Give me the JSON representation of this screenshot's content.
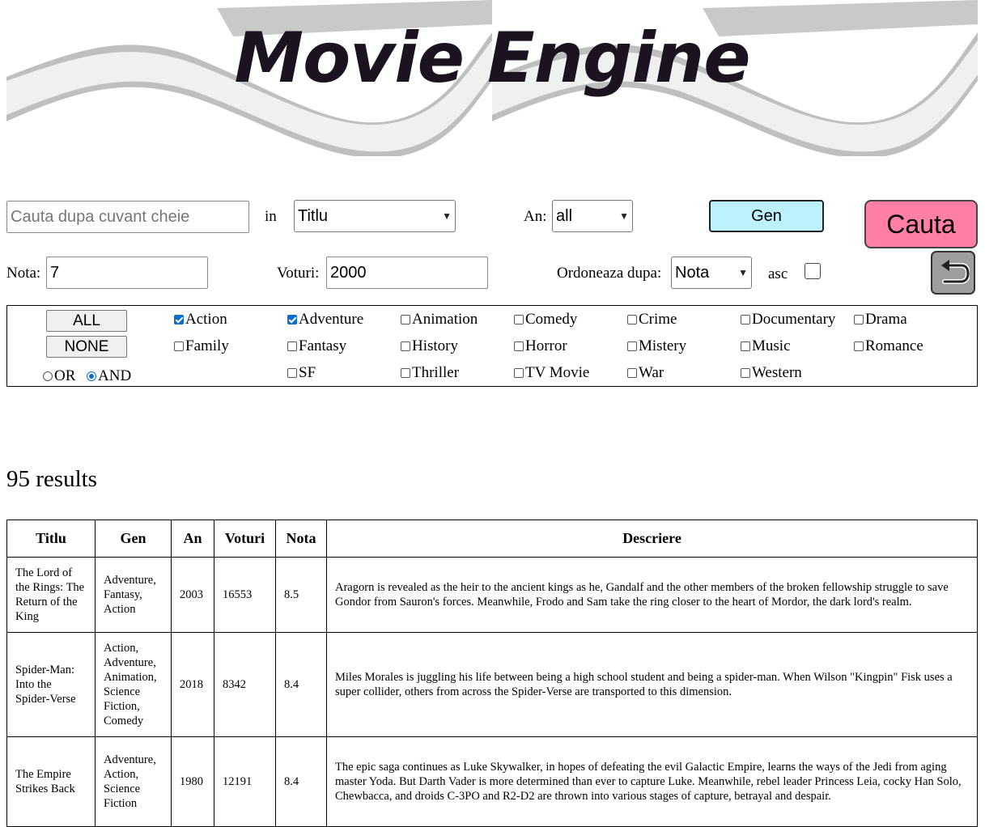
{
  "header": {
    "logo_text": "Movie Engine"
  },
  "search": {
    "keyword_placeholder": "Cauta dupa cuvant cheie",
    "in_label": "in",
    "field_selected": "Titlu",
    "year_label": "An:",
    "year_selected": "all",
    "genre_button": "Gen",
    "search_button": "Cauta",
    "rating_label": "Nota:",
    "rating_value": "7",
    "votes_label": "Voturi:",
    "votes_value": "2000",
    "sort_label": "Ordoneaza dupa:",
    "sort_selected": "Nota",
    "asc_label": "asc",
    "asc_checked": false
  },
  "genres": {
    "all_button": "ALL",
    "none_button": "NONE",
    "or_label": "OR",
    "and_label": "AND",
    "mode_selected": "AND",
    "items": [
      {
        "label": "Action",
        "checked": true
      },
      {
        "label": "Adventure",
        "checked": true
      },
      {
        "label": "Animation",
        "checked": false
      },
      {
        "label": "Comedy",
        "checked": false
      },
      {
        "label": "Crime",
        "checked": false
      },
      {
        "label": "Documentary",
        "checked": false
      },
      {
        "label": "Drama",
        "checked": false
      },
      {
        "label": "Family",
        "checked": false
      },
      {
        "label": "Fantasy",
        "checked": false
      },
      {
        "label": "History",
        "checked": false
      },
      {
        "label": "Horror",
        "checked": false
      },
      {
        "label": "Mistery",
        "checked": false
      },
      {
        "label": "Music",
        "checked": false
      },
      {
        "label": "Romance",
        "checked": false
      },
      {
        "label": "SF",
        "checked": false
      },
      {
        "label": "Thriller",
        "checked": false
      },
      {
        "label": "TV Movie",
        "checked": false
      },
      {
        "label": "War",
        "checked": false
      },
      {
        "label": "Western",
        "checked": false
      }
    ]
  },
  "results": {
    "count_text": "95 results",
    "columns": [
      "Titlu",
      "Gen",
      "An",
      "Voturi",
      "Nota",
      "Descriere"
    ],
    "rows": [
      {
        "title": "The Lord of the Rings: The Return of the King",
        "genre": "Adventure, Fantasy, Action",
        "year": "2003",
        "votes": "16553",
        "rating": "8.5",
        "description": "Aragorn is revealed as the heir to the ancient kings as he, Gandalf and the other members of the broken fellowship struggle to save Gondor from Sauron's forces. Meanwhile, Frodo and Sam take the ring closer to the heart of Mordor, the dark lord's realm."
      },
      {
        "title": "Spider-Man: Into the Spider-Verse",
        "genre": "Action, Adventure, Animation, Science Fiction, Comedy",
        "year": "2018",
        "votes": "8342",
        "rating": "8.4",
        "description": "Miles Morales is juggling his life between being a high school student and being a spider-man. When Wilson \"Kingpin\" Fisk uses a super collider, others from across the Spider-Verse are transported to this dimension."
      },
      {
        "title": "The Empire Strikes Back",
        "genre": "Adventure, Action, Science Fiction",
        "year": "1980",
        "votes": "12191",
        "rating": "8.4",
        "description": "The epic saga continues as Luke Skywalker, in hopes of defeating the evil Galactic Empire, learns the ways of the Jedi from aging master Yoda. But Darth Vader is more determined than ever to capture Luke. Meanwhile, rebel leader Princess Leia, cocky Han Solo, Chewbacca, and droids C-3PO and R2-D2 are thrown into various stages of capture, betrayal and despair."
      }
    ]
  }
}
